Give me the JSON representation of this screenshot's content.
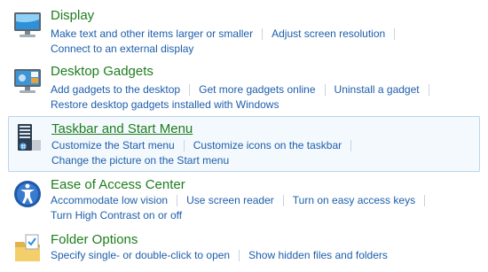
{
  "categories": [
    {
      "title": "Display",
      "icon": "monitor-icon",
      "row1": [
        "Make text and other items larger or smaller",
        "Adjust screen resolution"
      ],
      "row2": [
        "Connect to an external display"
      ]
    },
    {
      "title": "Desktop Gadgets",
      "icon": "gadgets-icon",
      "row1": [
        "Add gadgets to the desktop",
        "Get more gadgets online",
        "Uninstall a gadget"
      ],
      "row2": [
        "Restore desktop gadgets installed with Windows"
      ]
    },
    {
      "title": "Taskbar and Start Menu",
      "icon": "taskbar-icon",
      "row1": [
        "Customize the Start menu",
        "Customize icons on the taskbar"
      ],
      "row2": [
        "Change the picture on the Start menu"
      ]
    },
    {
      "title": "Ease of Access Center",
      "icon": "ease-of-access-icon",
      "row1": [
        "Accommodate low vision",
        "Use screen reader",
        "Turn on easy access keys"
      ],
      "row2": [
        "Turn High Contrast on or off"
      ]
    },
    {
      "title": "Folder Options",
      "icon": "folder-options-icon",
      "row1": [
        "Specify single- or double-click to open",
        "Show hidden files and folders"
      ],
      "row2": []
    }
  ]
}
